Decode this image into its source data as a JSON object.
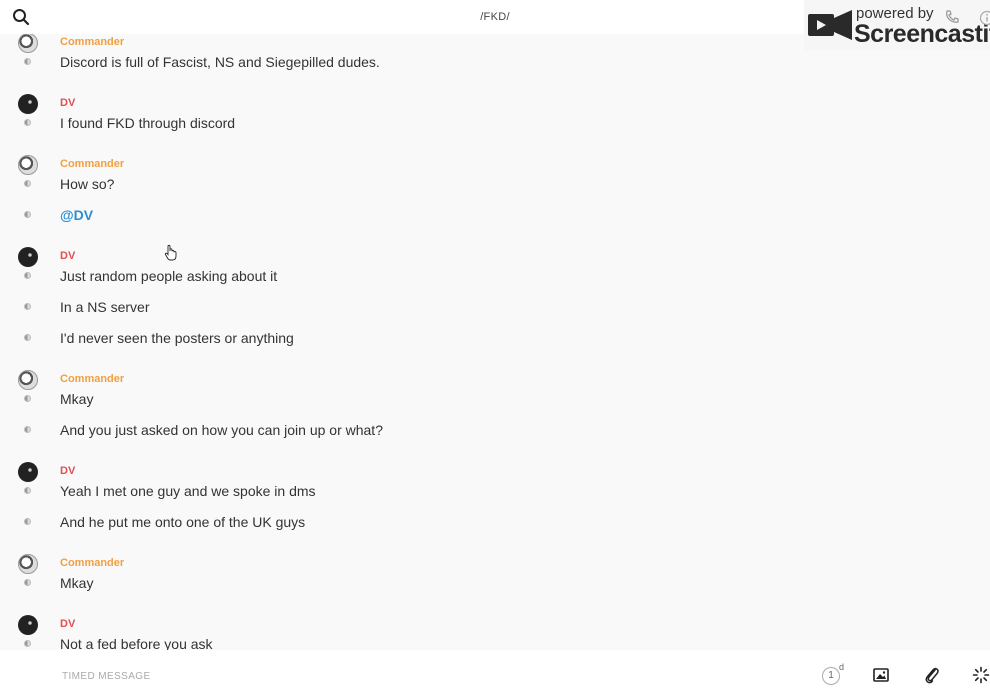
{
  "header": {
    "channel_title": "/FKD/",
    "search_icon": "search-icon"
  },
  "watermark": {
    "powered_by": "powered by",
    "brand": "Screencastify"
  },
  "messages": [
    {
      "author": "Commander",
      "author_color": "#f0a040",
      "avatar": "commander-avatar",
      "lines": [
        "Discord is full of Fascist, NS and Siegepilled dudes."
      ]
    },
    {
      "author": "DV",
      "author_color": "#e05050",
      "avatar": "dv-avatar",
      "lines": [
        "I found FKD through discord"
      ]
    },
    {
      "author": "Commander",
      "author_color": "#f0a040",
      "avatar": "commander-avatar",
      "lines": [
        "How so?",
        "@DV"
      ]
    },
    {
      "author": "DV",
      "author_color": "#e05050",
      "avatar": "dv-avatar",
      "lines": [
        "Just random people asking about it",
        "In a NS server",
        "I'd never seen the posters or anything"
      ]
    },
    {
      "author": "Commander",
      "author_color": "#f0a040",
      "avatar": "commander-avatar",
      "lines": [
        "Mkay",
        "And you just asked on how you can join up or what?"
      ]
    },
    {
      "author": "DV",
      "author_color": "#e05050",
      "avatar": "dv-avatar",
      "lines": [
        "Yeah I met one guy and we spoke in dms",
        "And he put me onto one of the UK guys"
      ]
    },
    {
      "author": "Commander",
      "author_color": "#f0a040",
      "avatar": "commander-avatar",
      "lines": [
        "Mkay"
      ]
    },
    {
      "author": "DV",
      "author_color": "#e05050",
      "avatar": "dv-avatar",
      "lines": [
        "Not a fed before you ask"
      ]
    }
  ],
  "composer": {
    "placeholder": "TIMED MESSAGE",
    "timer_value": "1",
    "timer_unit": "d"
  }
}
